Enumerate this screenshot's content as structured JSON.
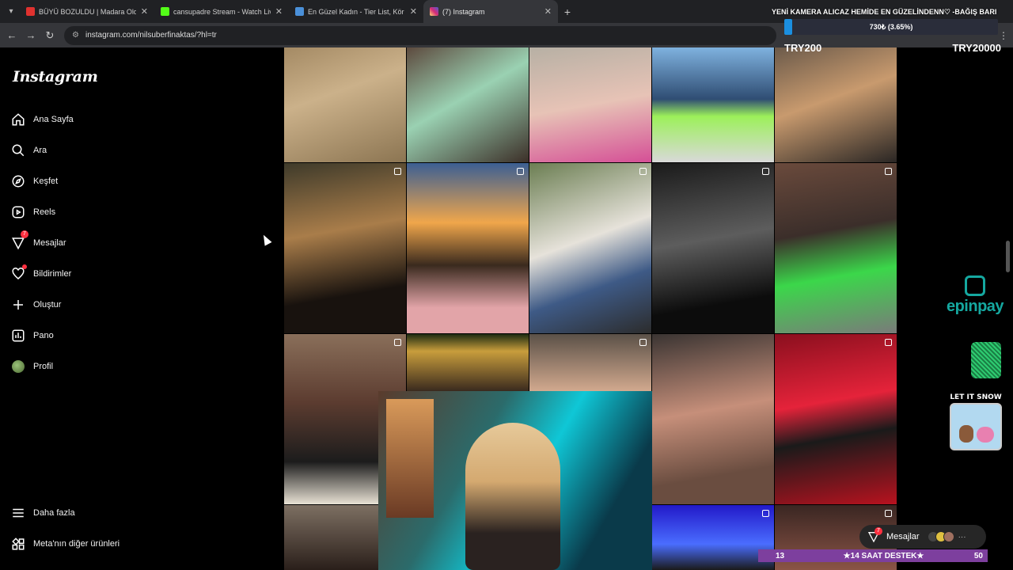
{
  "browser": {
    "tabs": [
      {
        "title": "BÜYÜ BOZULDU | Madara Oldu",
        "favicon_color": "#e0322f",
        "active": false
      },
      {
        "title": "cansupadre Stream - Watch Live",
        "favicon_color": "#53fc18",
        "active": false
      },
      {
        "title": "En Güzel Kadın - Tier List, Kör Sır",
        "favicon_color": "#4a90d9",
        "active": false
      },
      {
        "title": "(7) Instagram",
        "favicon_color": "#d6249f",
        "active": true
      }
    ],
    "url": "instagram.com/nilsuberfinaktas/?hl=tr"
  },
  "sidebar": {
    "logo": "Instagram",
    "items": [
      {
        "label": "Ana Sayfa",
        "icon": "home-icon"
      },
      {
        "label": "Ara",
        "icon": "search-icon"
      },
      {
        "label": "Keşfet",
        "icon": "compass-icon"
      },
      {
        "label": "Reels",
        "icon": "reels-icon"
      },
      {
        "label": "Mesajlar",
        "icon": "messenger-icon",
        "badge": "7"
      },
      {
        "label": "Bildirimler",
        "icon": "heart-icon"
      },
      {
        "label": "Oluştur",
        "icon": "plus-icon"
      },
      {
        "label": "Pano",
        "icon": "chart-icon"
      },
      {
        "label": "Profil",
        "icon": "avatar"
      }
    ],
    "bottom_items": [
      {
        "label": "Daha fazla",
        "icon": "menu-icon"
      },
      {
        "label": "Meta'nın diğer ürünleri",
        "icon": "grid-icon"
      }
    ]
  },
  "stream_overlay": {
    "goal_text": "YENİ KAMERA ALICAZ HEMİDE EN GÜZELİNDENN♡ -BAĞIŞ BARI",
    "goal_percent_text": "730₺ (3.65%)",
    "goal_fraction": 0.0365,
    "goal_min": "TRY200",
    "goal_max": "TRY20000",
    "sponsor": "epinpay",
    "snow_title": "LET IT SNOW",
    "support_level": "13",
    "support_text": "★14 SAAT DESTEK★",
    "support_count": "50"
  },
  "messages_pill": {
    "label": "Mesajlar",
    "badge": "7"
  }
}
